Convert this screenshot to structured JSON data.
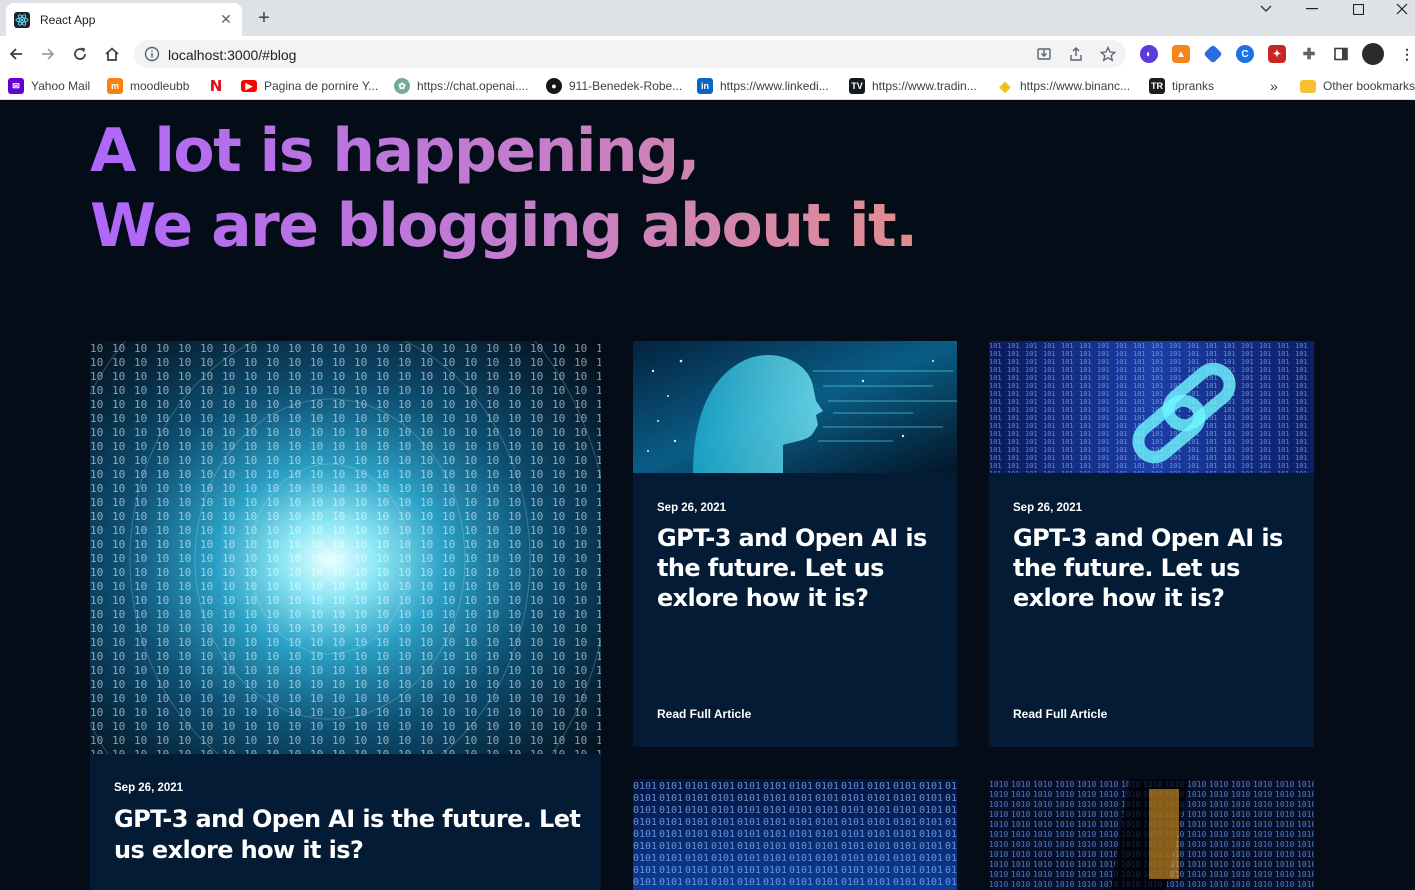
{
  "browser": {
    "tab_title": "React App",
    "url": "localhost:3000/#blog",
    "bookmarks": [
      {
        "label": "Yahoo Mail",
        "icon": "yahoo-mail-icon",
        "color": "#6001d2"
      },
      {
        "label": "moodleubb",
        "icon": "moodle-icon",
        "color": "#f98012"
      },
      {
        "label": "",
        "icon": "netflix-icon",
        "color": "#e50914"
      },
      {
        "label": "Pagina de pornire Y...",
        "icon": "youtube-icon",
        "color": "#ff0000"
      },
      {
        "label": "https://chat.openai....",
        "icon": "openai-icon",
        "color": "#74aa9c"
      },
      {
        "label": "911-Benedek-Robe...",
        "icon": "github-icon",
        "color": "#181717"
      },
      {
        "label": "https://www.linkedi...",
        "icon": "linkedin-icon",
        "color": "#0a66c2"
      },
      {
        "label": "https://www.tradin...",
        "icon": "tradingview-icon",
        "color": "#131722"
      },
      {
        "label": "https://www.binanc...",
        "icon": "binance-icon",
        "color": "#f0b90b"
      },
      {
        "label": "tipranks",
        "icon": "tipranks-icon",
        "color": "#1d1d1b"
      }
    ],
    "overflow_label": "»",
    "other_bookmarks": "Other bookmarks"
  },
  "blog": {
    "heading_line1": "A lot is happening,",
    "heading_line2": "We are blogging about it.",
    "cards": [
      {
        "date": "Sep 26, 2021",
        "title": "GPT-3 and Open AI is the future. Let us exlore how it is?"
      },
      {
        "date": "Sep 26, 2021",
        "title": "GPT-3 and Open AI is the future. Let us exlore how it is?",
        "read": "Read Full Article"
      },
      {
        "date": "Sep 26, 2021",
        "title": "GPT-3 and Open AI is the future. Let us exlore how it is?",
        "read": "Read Full Article"
      }
    ]
  },
  "colors": {
    "page_bg": "#040C18",
    "card_bg": "#031B34",
    "gradient_start": "#AE67FA",
    "gradient_end": "#F49867"
  }
}
